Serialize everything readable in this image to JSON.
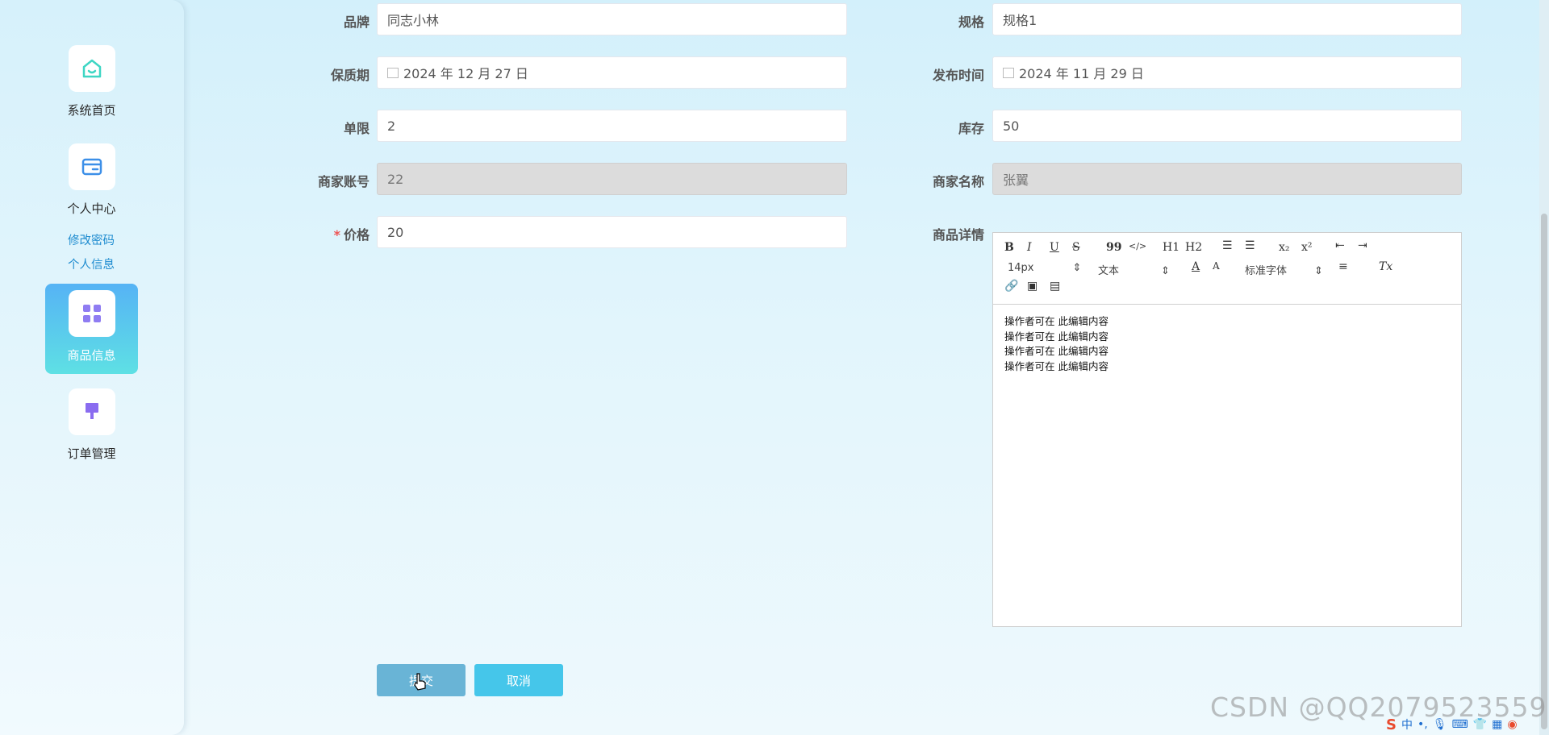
{
  "sidebar": {
    "items": [
      {
        "label": "系统首页",
        "icon": "home-icon"
      },
      {
        "label": "个人中心",
        "icon": "wallet-icon"
      },
      {
        "label": "商品信息",
        "icon": "grid-icon"
      },
      {
        "label": "订单管理",
        "icon": "brush-icon"
      }
    ],
    "submenu": [
      {
        "label": "修改密码"
      },
      {
        "label": "个人信息"
      }
    ]
  },
  "form": {
    "brand_label": "品牌",
    "brand_value": "同志小林",
    "spec_label": "规格",
    "spec_value": "规格1",
    "shelf_label": "保质期",
    "shelf_value": "2024 年 12 月 27 日",
    "pub_label": "发布时间",
    "pub_value": "2024 年 11 月 29 日",
    "limit_label": "单限",
    "limit_value": "2",
    "stock_label": "库存",
    "stock_value": "50",
    "account_label": "商家账号",
    "account_value": "22",
    "merchant_label": "商家名称",
    "merchant_value": "张翼",
    "price_label": "价格",
    "price_value": "20",
    "required_mark": "*",
    "detail_label": "商品详情"
  },
  "editor": {
    "toolbar": {
      "bold": "B",
      "italic": "I",
      "underline": "U",
      "strike": "S",
      "quote": "99",
      "code": "</>",
      "h1": "H1",
      "h2": "H2",
      "sub": "x₂",
      "sup": "x²",
      "size": "14px",
      "format": "文本",
      "font": "标准字体",
      "clear": "Tx"
    },
    "lines": [
      "操作者可在 此编辑内容",
      "操作者可在 此编辑内容",
      "操作者可在 此编辑内容",
      "操作者可在 此编辑内容"
    ]
  },
  "buttons": {
    "submit": "提交",
    "cancel": "取消"
  },
  "colors": {
    "submit": "#69b4d6",
    "cancel": "#45c6ea",
    "active_top": "#56b3f5",
    "active_bottom": "#5ee0e4"
  },
  "watermark": "CSDN @QQ2079523559",
  "tray": {
    "ime": "中"
  }
}
